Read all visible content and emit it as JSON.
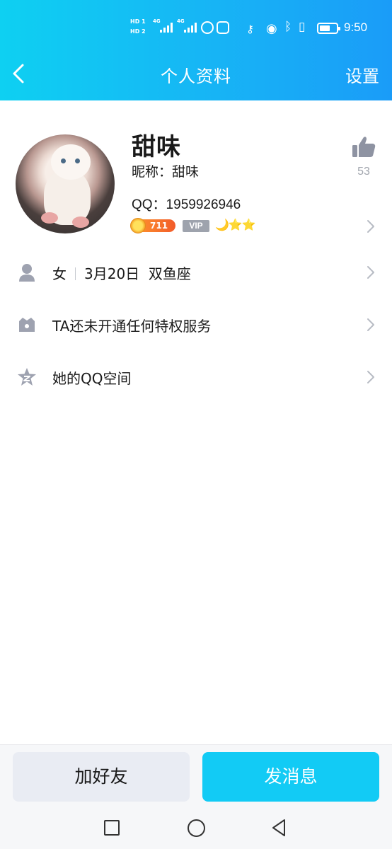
{
  "status_bar": {
    "hd1": "HD 1",
    "hd2": "HD 2",
    "net1": "4G",
    "net2": "4G",
    "time": "9:50",
    "icons": [
      "signal-icon",
      "globe-icon",
      "key-icon",
      "eye-icon",
      "bluetooth-icon",
      "vibrate-icon",
      "battery-icon"
    ]
  },
  "header": {
    "back_icon": "chevron-left-icon",
    "title": "个人资料",
    "settings_label": "设置",
    "gradient": [
      "#0ed0f2",
      "#1a9cf8"
    ]
  },
  "profile": {
    "name": "甜味",
    "nickname": "昵称：甜味",
    "qq": "QQ：1959926946",
    "coin_level": "711",
    "vip_label": "VIP",
    "level_icons": "🌙⭐⭐",
    "likes": "53"
  },
  "rows": [
    {
      "icon": "person-icon",
      "gender": "女",
      "birthday": "3月20日",
      "zodiac": "双鱼座"
    },
    {
      "icon": "crown-icon",
      "label": "TA还未开通任何特权服务"
    },
    {
      "icon": "qzone-star-icon",
      "label": "她的QQ空间"
    }
  ],
  "actions": {
    "add_friend": "加好友",
    "send_message": "发消息",
    "accent": "#12cbf5"
  },
  "navigation": [
    "recent-apps-icon",
    "home-icon",
    "back-icon"
  ]
}
